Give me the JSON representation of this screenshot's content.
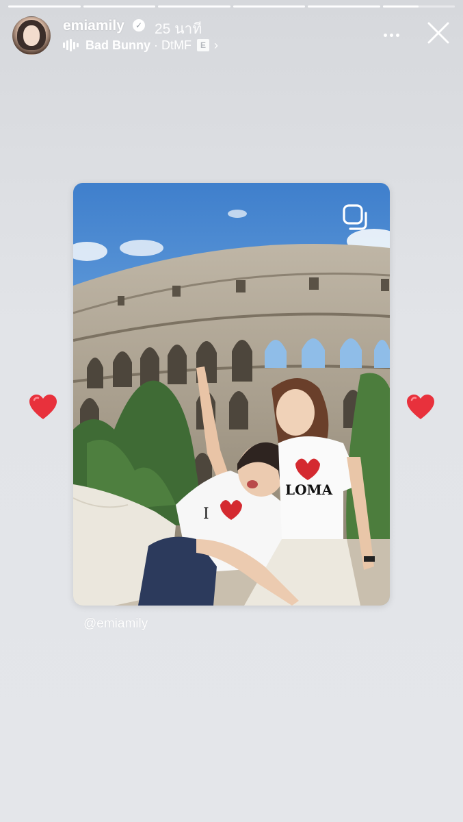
{
  "progress": {
    "segments_total": 6,
    "segments_complete": 5,
    "current_segment_fill": 0.5
  },
  "header": {
    "username": "emiamily",
    "verified_icon": "verified-badge-icon",
    "time_ago": "25 นาที",
    "music": {
      "icon": "audio-wave-icon",
      "artist": "Bad Bunny",
      "separator": "·",
      "title": "DtMF",
      "explicit_label": "E",
      "chevron": "›"
    },
    "more_icon": "more-horizontal-icon",
    "close_icon": "close-icon"
  },
  "post": {
    "multi_image_icon": "carousel-icon",
    "mention": "@emiamily"
  },
  "stickers": {
    "left": "heart-emoji-icon",
    "right": "heart-emoji-icon",
    "heart_color": "#e8313c"
  },
  "colors": {
    "background": "#e1e3e7",
    "text": "#ffffff",
    "sky": "#5b8fcf"
  }
}
